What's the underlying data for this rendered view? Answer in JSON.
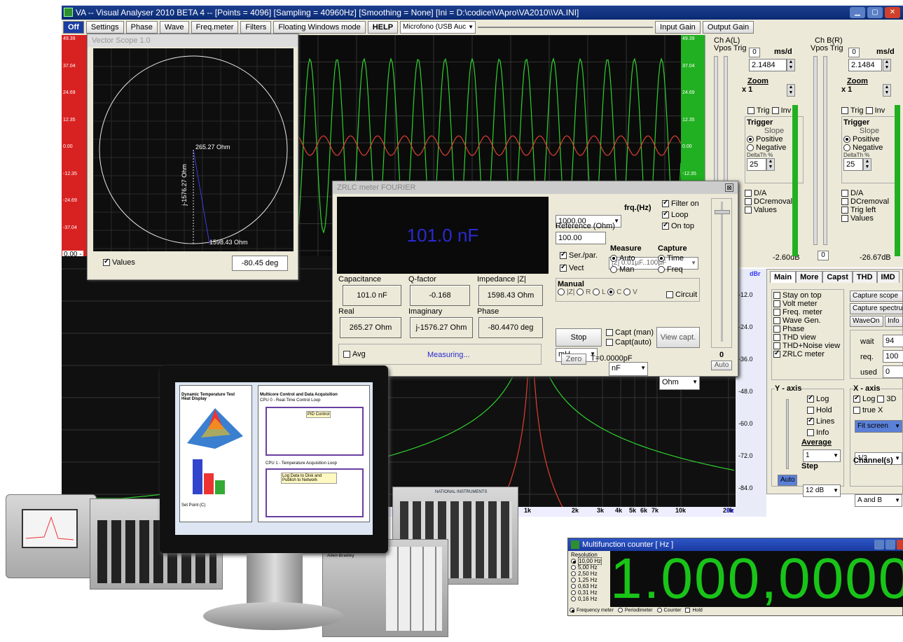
{
  "window": {
    "title": "VA -- Visual Analyser 2010 BETA 4 --  [Points = 4096]  [Sampling = 40960Hz]  [Smoothing = None]  [Ini = D:\\codice\\VApro\\VA2010\\\\VA.INI]"
  },
  "menubar": {
    "off": "Off",
    "settings": "Settings",
    "phase": "Phase",
    "wave": "Wave",
    "freqmeter": "Freq.meter",
    "filters": "Filters",
    "floating": "Floating Windows mode",
    "help": "HELP",
    "input_device": "Microfono (USB Auc",
    "input_gain": "Input Gain",
    "output_gain": "Output Gain"
  },
  "scope": {
    "left_ticks": [
      "49.39",
      "37.04",
      "24.69",
      "12.35",
      "0.00",
      "-12.35",
      "-24.69",
      "-37.04",
      "-49.39"
    ],
    "right_ticks": [
      "49.39",
      "37.04",
      "24.69",
      "12.35",
      "0.00",
      "-12.35"
    ],
    "left_bottom": "0.00 -",
    "right_bottom_db": "dBr"
  },
  "spectrum": {
    "db_ticks": [
      "-12.0",
      "-24.0",
      "-36.0",
      "-48.0",
      "-60.0",
      "-72.0",
      "-84.0"
    ],
    "freq_ticks": [
      "1k",
      "2k",
      "3k",
      "4k",
      "5k",
      "6k",
      "7k",
      "10k",
      "20k"
    ],
    "axis_unit": "Hz"
  },
  "channel_a": {
    "title": "Ch A(L)",
    "vpos_trig": "Vpos Trig",
    "zero": "0",
    "msd_label": "ms/d",
    "msd_value": "2.1484",
    "zoom_label": "Zoom",
    "zoom_value": "x 1",
    "trig": "Trig",
    "inv": "Inv",
    "trigger": "Trigger",
    "slope": "Slope",
    "positive": "Positive",
    "negative": "Negative",
    "delta": "DeltaTh %",
    "delta_value": "25",
    "da": "D/A",
    "dcremoval": "DCremoval",
    "values": "Values",
    "db_readout": "-2.60dB"
  },
  "channel_b": {
    "title": "Ch B(R)",
    "vpos_trig": "Vpos Trig",
    "zero": "0",
    "msd_label": "ms/d",
    "msd_value": "2.1484",
    "zoom_label": "Zoom",
    "zoom_value": "x 1",
    "trig": "Trig",
    "inv": "Inv",
    "trigger": "Trigger",
    "slope": "Slope",
    "positive": "Positive",
    "negative": "Negative",
    "delta": "DeltaTh %",
    "delta_value": "25",
    "da": "D/A",
    "dcremoval": "DCremoval",
    "trig_left": "Trig left",
    "values": "Values",
    "zero_box": "0",
    "db_readout": "-26.67dB"
  },
  "main_tabs": {
    "tabs": [
      "Main",
      "More",
      "Capst",
      "THD",
      "IMD"
    ],
    "options": [
      "Stay on top",
      "Volt meter",
      "Freq. meter",
      "Wave Gen.",
      "Phase",
      "THD view",
      "THD+Noise view",
      "ZRLC meter"
    ],
    "capture_scope": "Capture scope",
    "capture_spectrum": "Capture spectrum",
    "wave_on": "WaveOn",
    "info": "Info",
    "wait_label": "wait",
    "wait_value": "94",
    "req_label": "req.",
    "req_value": "100",
    "used_label": "used",
    "used_value": "0",
    "yaxis": "Y - axis",
    "log": "Log",
    "hold": "Hold",
    "lines": "Lines",
    "info_cb": "Info",
    "average": "Average",
    "average_value": "1",
    "step": "Step",
    "step_value": "12 dB",
    "auto": "Auto",
    "xaxis": "X - axis",
    "xlog": "Log",
    "x3d": "3D",
    "truex": "true X",
    "fit_screen": "Fit screen",
    "octave": "1/3",
    "channels": "Channel(s)",
    "channels_value": "A and B"
  },
  "vector_scope": {
    "title": "Vector Scope 1.0",
    "real_label": "265.27 Ohm",
    "imag_label": "j-1576.27 Ohm",
    "mag_label": "1598.43 Ohm",
    "values": "Values",
    "phase_readout": "-80.45 deg"
  },
  "zrlc": {
    "title": "ZRLC meter FOURIER",
    "display": "101.0 nF",
    "capacitance_label": "Capacitance",
    "capacitance": "101.0 nF",
    "qfactor_label": "Q-factor",
    "qfactor": "-0.168",
    "impedance_label": "Impedance |Z|",
    "impedance": "1598.43 Ohm",
    "real_label": "Real",
    "real": "265.27 Ohm",
    "imaginary_label": "Imaginary",
    "imaginary": "j-1576.27 Ohm",
    "phase_label": "Phase",
    "phase": "-80.4470 deg",
    "avg": "Avg",
    "status": "Measuring...",
    "freq_value": "1000.00",
    "freq_unit": "frq.(Hz)",
    "filter_on": "Filter on",
    "loop": "Loop",
    "on_top": "On top",
    "reference_label": "Reference (Ohm)",
    "reference_value": "100.00",
    "range": "[2] 0.01µF..100µF",
    "ser_par": "Ser./par.",
    "vect": "Vect",
    "measure": "Measure",
    "auto": "Auto",
    "man": "Man",
    "capture": "Capture",
    "time": "Time",
    "freq": "Freq",
    "manual": "Manual",
    "manual_z": "|Z|",
    "manual_r": "R",
    "manual_l": "L",
    "manual_c": "C",
    "manual_v": "V",
    "circuit": "Circuit",
    "unit_mh": "mH",
    "unit_nf": "nF",
    "unit_ohm": "Ohm",
    "stop": "Stop",
    "capt_man": "Capt (man)",
    "capt_auto": "Capt(auto)",
    "view_capt": "View capt.",
    "zero": "Zero",
    "t_readout": "T=0.0000pF",
    "slider_value": "0",
    "slider_auto": "Auto"
  },
  "counter": {
    "title": "Multifunction counter [ Hz ]",
    "resolution_label": "Resolution",
    "resolutions": [
      "10,00 Hz",
      "5,00 Hz",
      "2,50 Hz",
      "1,25 Hz",
      "0,63 Hz",
      "0,31 Hz",
      "0,16 Hz"
    ],
    "display": "1.000,0000",
    "modes": [
      "Frequency meter",
      "Periodimeter",
      "Counter",
      "Hold"
    ]
  },
  "photo_monitor": {
    "left_title": "Dynamic Temperature Test",
    "left_sub": "Heat Display",
    "right_title": "Multicore Control and Data Acquisition",
    "loop0": "CPU 0 - Real-Time Control Loop",
    "pid": "PID Control",
    "loop1": "CPU 1 - Temperature Acquisition Loop",
    "logdata": "Log Data to Disk and Publish to Network",
    "set_point": "Set Point (C)",
    "brand": "NATIONAL INSTRUMENTS",
    "plc_brand": "Allen-Bradley"
  },
  "colors": {
    "red_bar": "#d82222",
    "green_bar": "#21b021",
    "wave_green": "#2fd12f",
    "wave_red": "#e04030",
    "zrlc_display": "#2a2ad0",
    "counter_digits": "#19c419"
  }
}
